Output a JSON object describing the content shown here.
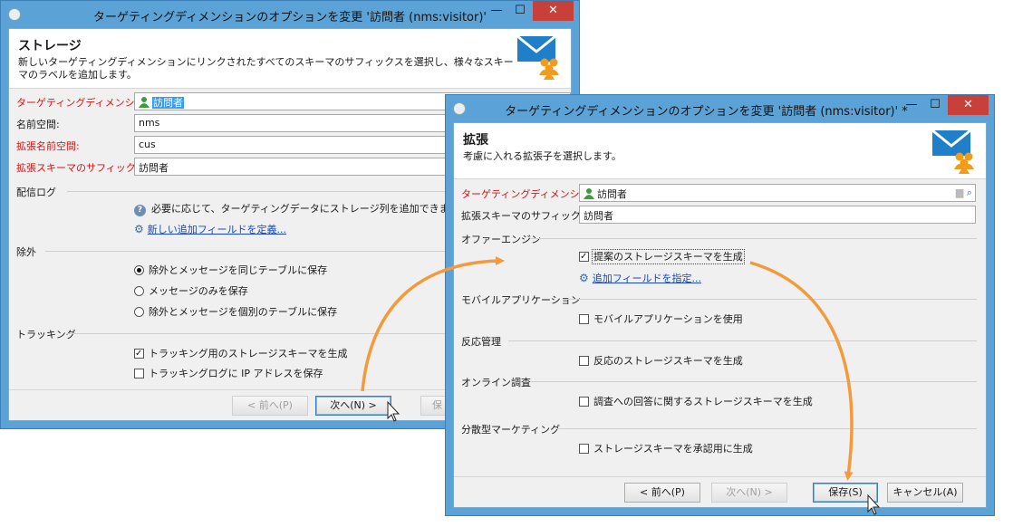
{
  "back_window": {
    "title": "ターゲティングディメンションのオプションを変更 '訪問者 (nms:visitor)'",
    "header_title": "ストレージ",
    "header_desc": "新しいターゲティングディメンションにリンクされたすべてのスキーマのサフィックスを選択し、様々なスキーマのラベルを追加します。",
    "fields": {
      "targeting_label": "ターゲティングディメンション:",
      "targeting_value": "訪問者",
      "namespace_label": "名前空間:",
      "namespace_value": "nms",
      "ext_namespace_label": "拡張名前空間:",
      "ext_namespace_value": "cus",
      "ext_suffix_label": "拡張スキーマのサフィックス:",
      "ext_suffix_value": "訪問者"
    },
    "delivery_log_section": "配信ログ",
    "delivery_log_help": "必要に応じて、ターゲティングデータにストレージ列を追加できます。",
    "delivery_log_link": "新しい追加フィールドを定義...",
    "exclusion_section": "除外",
    "exclusion_options": [
      "除外とメッセージを同じテーブルに保存",
      "メッセージのみを保存",
      "除外とメッセージを個別のテーブルに保存"
    ],
    "tracking_section": "トラッキング",
    "tracking_options": [
      "トラッキング用のストレージスキーマを生成",
      "トラッキングログに IP アドレスを保存"
    ],
    "buttons": {
      "prev": "< 前へ(P)",
      "next": "次へ(N) >",
      "save_partial": "保"
    }
  },
  "front_window": {
    "title": "ターゲティングディメンションのオプションを変更 '訪問者 (nms:visitor)' *",
    "header_title": "拡張",
    "header_desc": "考慮に入れる拡張子を選択します。",
    "fields": {
      "targeting_label": "ターゲティングディメンション:",
      "targeting_value": "訪問者",
      "ext_suffix_label": "拡張スキーマのサフィックス:",
      "ext_suffix_value": "訪問者"
    },
    "offer_section": "オファーエンジン",
    "offer_option": "提案のストレージスキーマを生成",
    "offer_link": "追加フィールドを指定...",
    "mobile_section": "モバイルアプリケーション",
    "mobile_option": "モバイルアプリケーションを使用",
    "response_section": "反応管理",
    "response_option": "反応のストレージスキーマを生成",
    "survey_section": "オンライン調査",
    "survey_option": "調査への回答に関するストレージスキーマを生成",
    "distributed_section": "分散型マーケティング",
    "distributed_option": "ストレージスキーマを承認用に生成",
    "buttons": {
      "prev": "< 前へ(P)",
      "next": "次へ(N) >",
      "save": "保存(S)",
      "cancel": "キャンセル(A)"
    }
  },
  "window_buttons": {
    "minimize": "—",
    "maximize": "☐",
    "close": "✕"
  },
  "colors": {
    "title_bar": "#5ba2d6",
    "close_button": "#c7403a",
    "required_label": "#dd1111",
    "arrow": "#f39a3c",
    "link": "#1a47c2"
  }
}
